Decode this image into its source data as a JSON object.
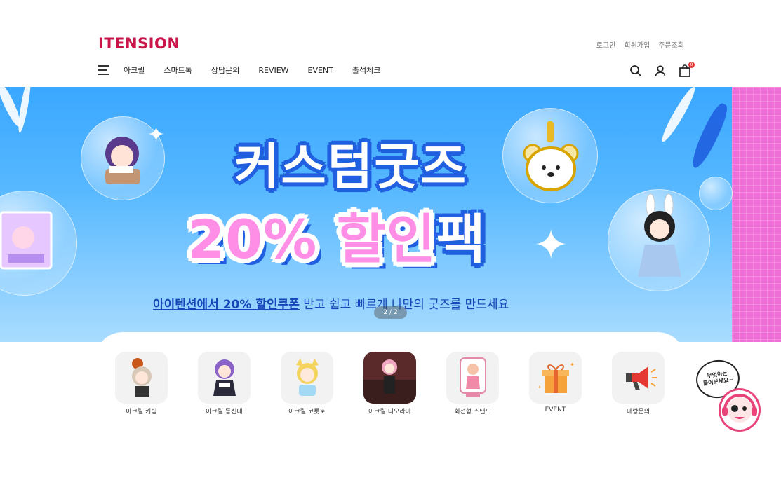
{
  "brand": {
    "logo": "ITENSION",
    "color": "#c8154a"
  },
  "top_links": [
    "로그인",
    "회원가입",
    "주문조회"
  ],
  "nav": {
    "menu_icon": "hamburger-icon",
    "items": [
      "아크릴",
      "스마트톡",
      "상담문의",
      "REVIEW",
      "EVENT",
      "출석체크"
    ]
  },
  "header_icons": {
    "search": "search-icon",
    "account": "user-icon",
    "cart": "shopping-bag-icon",
    "cart_count": "0"
  },
  "banner": {
    "headline_line1": "커스텀굿즈",
    "headline_line2_main": "20% 할인",
    "headline_line2_pack": "팩",
    "subline_highlight": "아이텐션에서 20% 할인쿠폰",
    "subline_rest": " 받고 쉽고 빠르게 나만의 굿즈를 만드세요",
    "pager": "2 / 2",
    "colors": {
      "sky": "#3aa7ff",
      "pink": "#ff8fe6",
      "outline": "#1f5fe0",
      "strip": "#ee6fd6"
    }
  },
  "categories": [
    {
      "label": "아크릴 키링",
      "icon": "acrylic-keyring-thumb"
    },
    {
      "label": "아크릴 등신대",
      "icon": "acrylic-standee-thumb"
    },
    {
      "label": "아크릴 코롯토",
      "icon": "acrylic-korotto-thumb"
    },
    {
      "label": "아크릴 디오라마",
      "icon": "acrylic-diorama-thumb"
    },
    {
      "label": "회전형 스탠드",
      "icon": "rotating-stand-thumb"
    },
    {
      "label": "EVENT",
      "icon": "gift-icon"
    },
    {
      "label": "대량문의",
      "icon": "megaphone-icon"
    }
  ],
  "chat_widget": {
    "text_line1": "무엇이든",
    "text_line2": "물어보세요~",
    "icon": "headset-mascot-icon"
  }
}
